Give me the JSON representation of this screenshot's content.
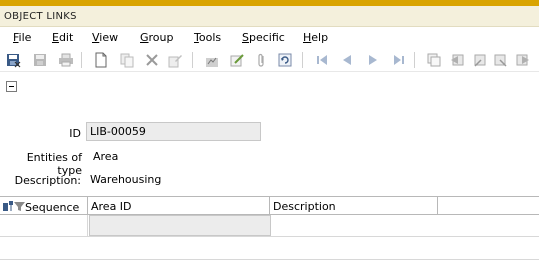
{
  "window": {
    "title": "OBJECT LINKS"
  },
  "menu": [
    {
      "label": "File",
      "u": "F",
      "rest": "ile"
    },
    {
      "label": "Edit",
      "u": "E",
      "rest": "dit"
    },
    {
      "label": "View",
      "u": "V",
      "rest": "iew"
    },
    {
      "label": "Group",
      "u": "G",
      "rest": "roup"
    },
    {
      "label": "Tools",
      "u": "T",
      "rest": "ools"
    },
    {
      "label": "Specific",
      "u": "S",
      "rest": "pecific"
    },
    {
      "label": "Help",
      "u": "H",
      "rest": "elp"
    }
  ],
  "toolbar": {
    "icons": [
      "save-close-icon",
      "save-icon",
      "print-icon",
      "new-document-icon",
      "copy-icon",
      "delete-icon",
      "edit-icon",
      "report-icon",
      "approve-icon",
      "attach-icon",
      "refresh-icon",
      "first-record-icon",
      "previous-record-icon",
      "next-record-icon",
      "last-record-icon",
      "window-icon",
      "nav-first-icon",
      "nav-prev-icon",
      "nav-next-icon",
      "nav-last-icon"
    ]
  },
  "form": {
    "id_label": "ID",
    "id_value": "LIB-00059",
    "entities_label": "Entities of type",
    "entities_value": "Area",
    "description_label": "Description:",
    "description_value": "Warehousing"
  },
  "grid": {
    "columns": [
      "Sequence",
      "Area ID",
      "Description"
    ],
    "rows": [
      [
        "",
        "",
        ""
      ]
    ]
  },
  "colors": {
    "accent": "#d9a400",
    "titlebar": "#f4f0dc",
    "field": "#ececec"
  }
}
